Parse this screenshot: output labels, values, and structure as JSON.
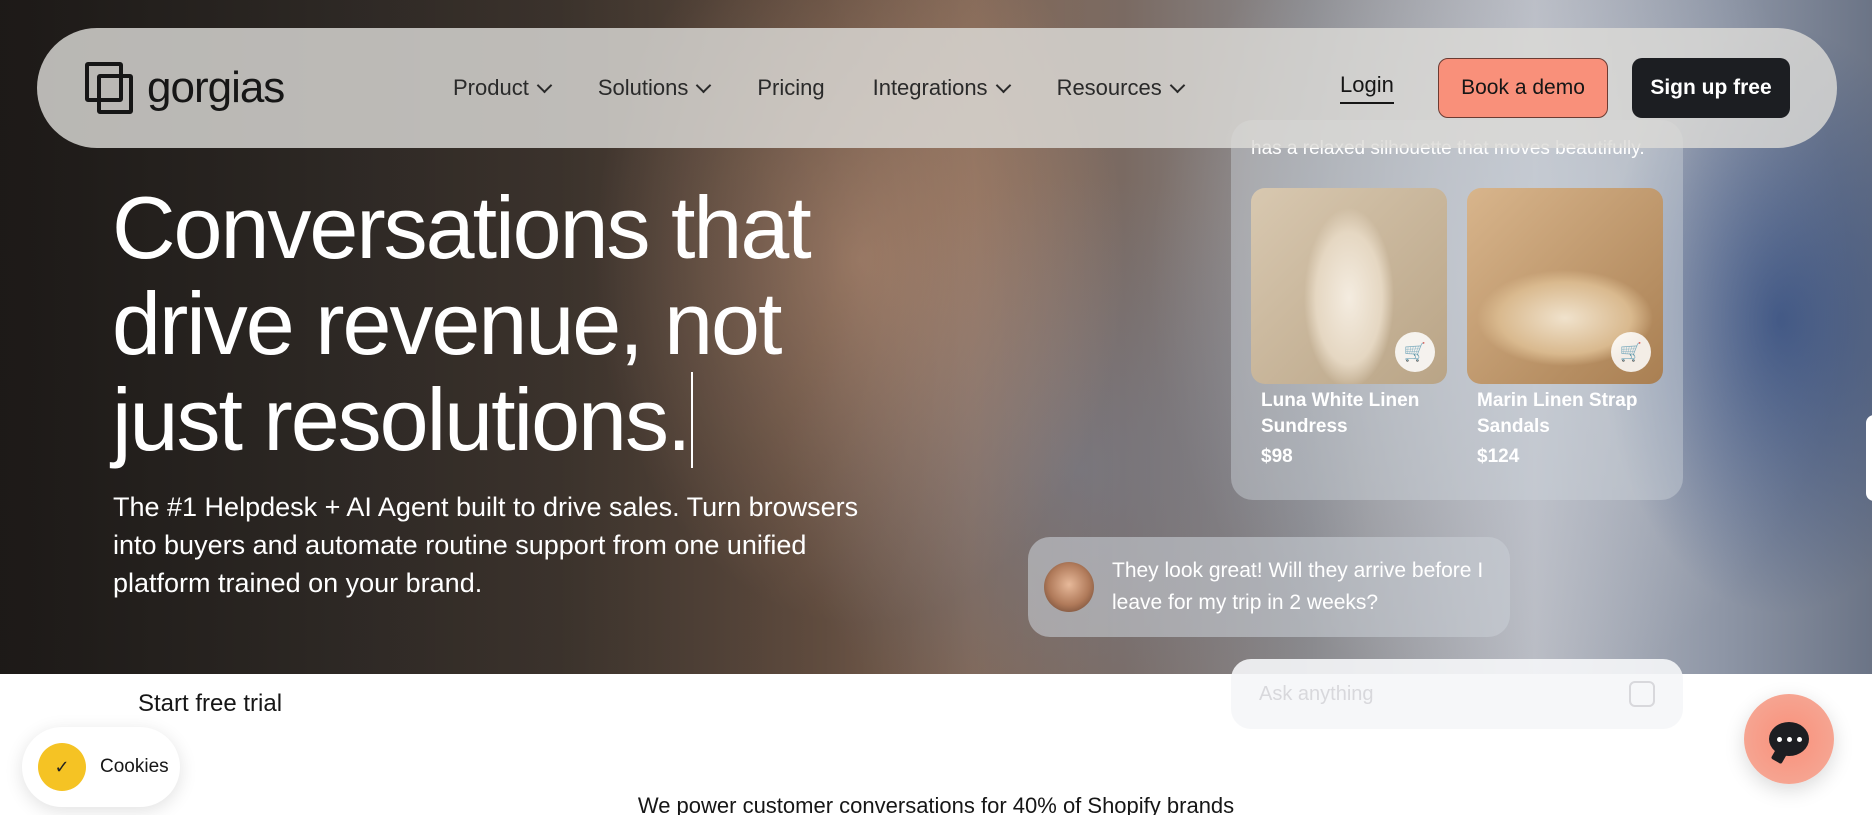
{
  "brand": {
    "logo_text": "gorgias"
  },
  "nav": {
    "items": [
      {
        "label": "Product",
        "has_dropdown": true
      },
      {
        "label": "Solutions",
        "has_dropdown": true
      },
      {
        "label": "Pricing",
        "has_dropdown": false
      },
      {
        "label": "Integrations",
        "has_dropdown": true
      },
      {
        "label": "Resources",
        "has_dropdown": true
      }
    ],
    "login": "Login",
    "book_demo": "Book a demo",
    "sign_up": "Sign up free"
  },
  "hero": {
    "headline": "Conversations that drive revenue, not just resolutions.",
    "subhead": "The #1 Helpdesk + AI Agent built to drive sales. Turn browsers into buyers and automate routine support from one unified platform trained on your brand.",
    "cta": "Start free trial"
  },
  "product_panel": {
    "caption": "has a relaxed silhouette that moves beautifully.",
    "products": [
      {
        "name": "Luna White Linen Sundress",
        "price": "$98",
        "cart_icon": "cart-plus-icon"
      },
      {
        "name": "Marin Linen Strap Sandals",
        "price": "$124",
        "cart_icon": "cart-plus-icon"
      }
    ]
  },
  "chat": {
    "message": "They look great! Will they arrive before I leave for my trip in 2 weeks?",
    "input_placeholder": "Ask anything"
  },
  "cookies": {
    "label": "Cookies",
    "icon": "cookie-check-icon"
  },
  "social_proof": "We power customer conversations for 40% of Shopify brands",
  "colors": {
    "accent": "#f9907a",
    "dark": "#1c1e22",
    "cookie_yellow": "#f5c324"
  }
}
